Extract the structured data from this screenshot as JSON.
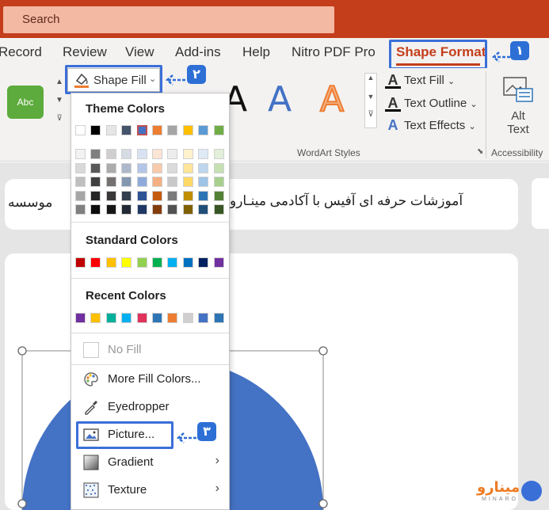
{
  "search": {
    "placeholder": "Search"
  },
  "tabs": [
    "Record",
    "Review",
    "View",
    "Add-ins",
    "Help",
    "Nitro PDF Pro",
    "Shape Format"
  ],
  "ribbon": {
    "style_preview": "Abc",
    "shape_fill_label": "Shape Fill",
    "wordart_letters": [
      "A",
      "A",
      "A"
    ],
    "text_fill_label": "Text Fill",
    "text_outline_label": "Text Outline",
    "text_effects_label": "Text Effects",
    "wordart_group_label": "WordArt Styles",
    "alt_text_line1": "Alt",
    "alt_text_line2": "Text",
    "accessibility_group_label": "Accessibility"
  },
  "slide": {
    "banner_text_rtl": "آموزشات حرفه ای آفیس با آکادمی مینـارو",
    "banner_text_left": "موسسه"
  },
  "menu": {
    "theme_colors_heading": "Theme Colors",
    "standard_colors_heading": "Standard Colors",
    "recent_colors_heading": "Recent Colors",
    "no_fill": "No Fill",
    "more_fill_colors": "More Fill Colors...",
    "eyedropper": "Eyedropper",
    "picture": "Picture...",
    "gradient": "Gradient",
    "texture": "Texture",
    "theme_top_row": [
      "#ffffff",
      "#000000",
      "#e7e6e6",
      "#44546a",
      "#4472c4",
      "#ed7d31",
      "#a5a5a5",
      "#ffc000",
      "#5b9bd5",
      "#70ad47"
    ],
    "theme_shade_columns": [
      [
        "#f2f2f2",
        "#d9d9d9",
        "#bfbfbf",
        "#a6a6a6",
        "#808080"
      ],
      [
        "#7f7f7f",
        "#595959",
        "#404040",
        "#262626",
        "#0d0d0d"
      ],
      [
        "#d0cece",
        "#aeabab",
        "#757070",
        "#3a3838",
        "#171616"
      ],
      [
        "#d6dce4",
        "#adb9ca",
        "#8496b0",
        "#333f4f",
        "#222a35"
      ],
      [
        "#d9e2f3",
        "#b4c6e7",
        "#8eaadb",
        "#2f5496",
        "#1f3864"
      ],
      [
        "#fbe5d5",
        "#f7caac",
        "#f4b083",
        "#c55a11",
        "#833c0b"
      ],
      [
        "#ededed",
        "#dbdbdb",
        "#c9c9c9",
        "#7b7b7b",
        "#525252"
      ],
      [
        "#fff2cc",
        "#fee599",
        "#ffd965",
        "#bf8f00",
        "#7f6000"
      ],
      [
        "#deeaf6",
        "#bdd7ee",
        "#9dc3e6",
        "#2e75b5",
        "#1f4e79"
      ],
      [
        "#e2efd9",
        "#c5e0b3",
        "#a8d08d",
        "#538135",
        "#375623"
      ]
    ],
    "standard_colors": [
      "#c00000",
      "#ff0000",
      "#ffc000",
      "#ffff00",
      "#92d050",
      "#00b050",
      "#00b0f0",
      "#0070c0",
      "#002060",
      "#7030a0"
    ],
    "recent_colors": [
      "#7030a0",
      "#ffc000",
      "#00b09b",
      "#00b0f0",
      "#e0325a",
      "#2e75b5",
      "#ed7d31",
      "#d0cece",
      "#4472c4",
      "#2e75b5"
    ]
  },
  "annotations": {
    "badge1": "١",
    "badge2": "٢",
    "badge3": "٣"
  },
  "logo": {
    "word": "مینارو",
    "sub": "MINARO"
  }
}
